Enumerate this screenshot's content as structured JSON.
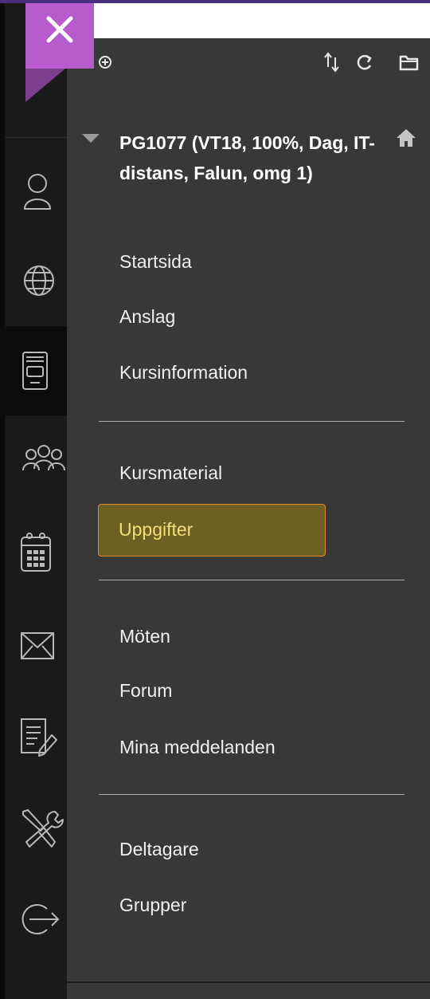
{
  "course": {
    "title": "PG1077 (VT18, 100%, Dag, IT-distans, Falun, omg 1)"
  },
  "menu": {
    "group1": [
      "Startsida",
      "Anslag",
      "Kursinformation"
    ],
    "group2": [
      "Kursmaterial",
      "Uppgifter"
    ],
    "group3": [
      "Möten",
      "Forum",
      "Mina meddelanden"
    ],
    "group4": [
      "Deltagare",
      "Grupper"
    ],
    "active_item": "Uppgifter"
  },
  "icons": {
    "close": "close-icon",
    "toolbar": [
      "add-circle-icon",
      "sort-arrows-icon",
      "refresh-icon",
      "folder-icon"
    ],
    "home": "home-icon",
    "rail": [
      "user-icon",
      "globe-icon",
      "course-icon",
      "group-icon",
      "calendar-icon",
      "mail-icon",
      "edit-document-icon",
      "tools-icon",
      "logout-icon"
    ]
  },
  "colors": {
    "close_button": "#b65ccd",
    "panel_background": "#383838",
    "rail_background": "#1a1a1a",
    "active_fill": "#6c6022",
    "active_border": "#e08a2d",
    "active_text": "#f4df77"
  }
}
